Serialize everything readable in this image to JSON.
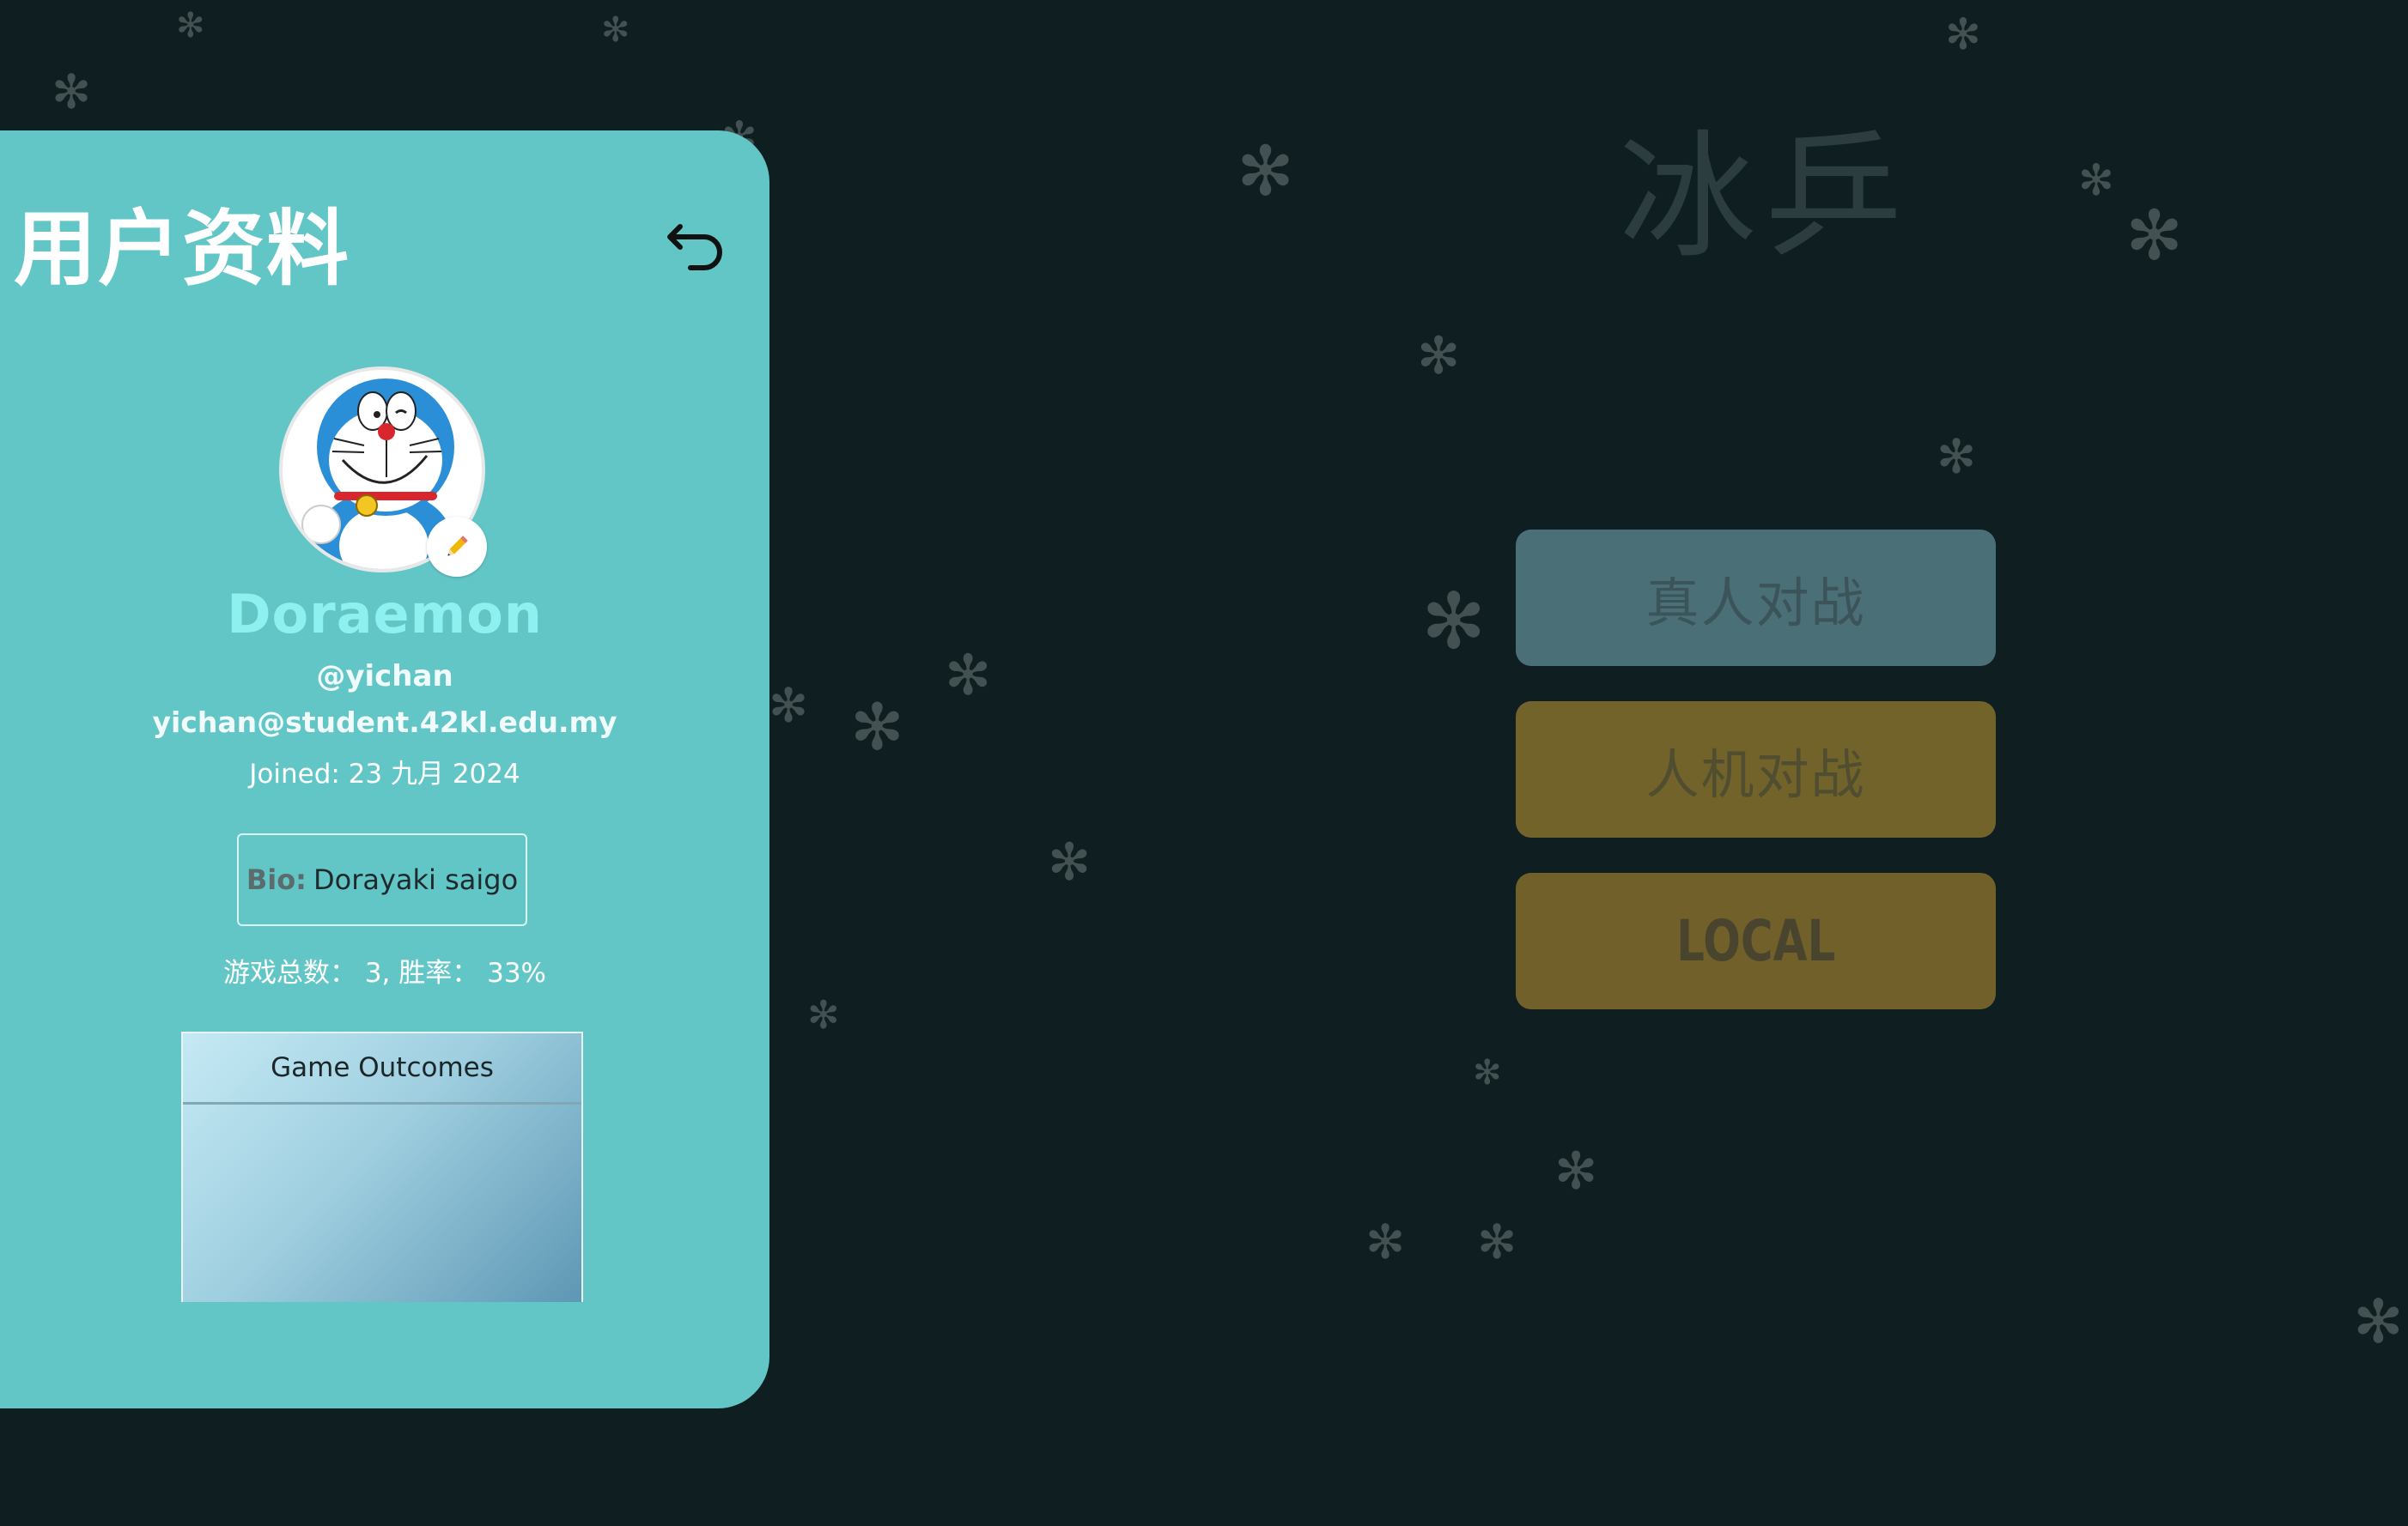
{
  "game": {
    "title": "冰乒"
  },
  "modes": {
    "pvp_label": "真人对战",
    "ai_label": "人机对战",
    "local_label": "LOCAL"
  },
  "profile": {
    "title": "用户资料",
    "display_name": "Doraemon",
    "username": "@yichan",
    "email": "yichan@student.42kl.edu.my",
    "joined": "Joined: 23 九月 2024",
    "bio_label": "Bio:",
    "bio_value": "Dorayaki saigo",
    "stats": "游戏总数： 3, 胜率： 33%",
    "chart_title": "Game Outcomes"
  },
  "icons": {
    "back": "undo-arrow-icon",
    "edit": "pencil-icon",
    "snow": "snowflake-icon"
  },
  "colors": {
    "background": "#0f1e20",
    "panel": "#62c6c7",
    "pvp_button": "#4b6f77",
    "ai_button": "#71632a",
    "local_button": "#71602a",
    "display_name": "#8ff0f0"
  }
}
